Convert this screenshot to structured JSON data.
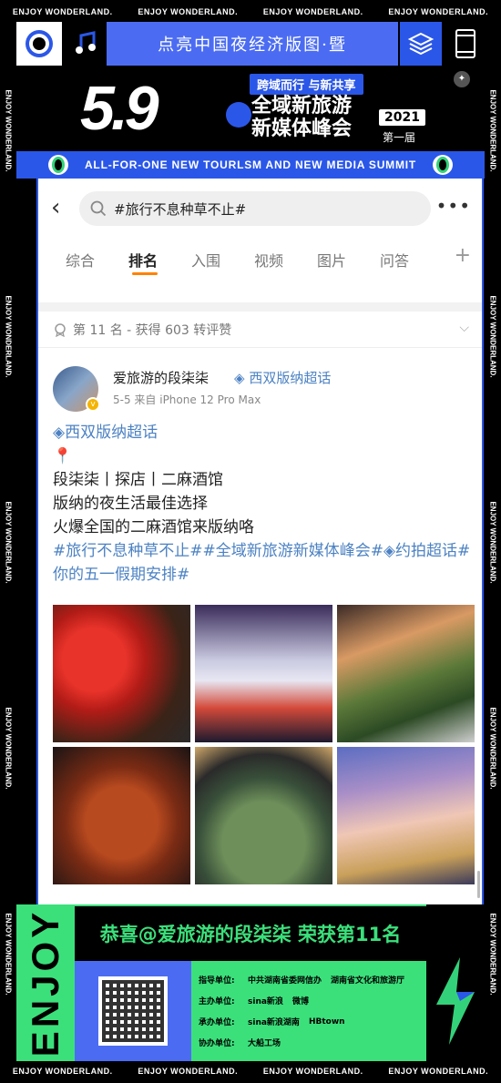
{
  "border": {
    "top_items": [
      "ENJOY WONDERLAND.",
      "ENJOY WONDERLAND.",
      "ENJOY WONDERLAND.",
      "ENJOY WONDERLAND."
    ],
    "bottom_items": [
      "ENJOY WONDERLAND.",
      "ENJOY WONDERLAND.",
      "ENJOY WONDERLAND.",
      "ENJOY WONDERLAND."
    ],
    "left_items": [
      "ENJOY WONDERLAND.",
      "ENJOY WONDERLAND.",
      "ENJOY WONDERLAND.",
      "ENJOY WONDERLAND.",
      "ENJOY WONDERLAND."
    ],
    "right_items": [
      "ENJOY WONDERLAND.",
      "ENJOY WONDERLAND.",
      "ENJOY WONDERLAND.",
      "ENJOY WONDERLAND.",
      "ENJOY WONDERLAND."
    ]
  },
  "header": {
    "banner_text": "点亮中国夜经济版图·暨"
  },
  "summit": {
    "number": "5.9",
    "tagline": "跨域而行  与新共享",
    "title_line1": "全域新旅游",
    "title_line2": "新媒体峰会",
    "year": "2021",
    "edition": "第一届",
    "band_text": "ALL-FOR-ONE NEW TOURLSM AND NEW MEDIA SUMMIT"
  },
  "app": {
    "search_query": "#旅行不息种草不止#",
    "tabs": [
      "综合",
      "排名",
      "入围",
      "视频",
      "图片",
      "问答"
    ],
    "active_tab": 1,
    "rank_text": "第 11 名 - 获得 603 转评赞",
    "post": {
      "username": "爱旅游的段柒柒",
      "user_topic": "西双版纳超话",
      "meta": "5-5  来自 iPhone 12 Pro Max",
      "topic_line": "西双版纳超话",
      "line1": "段柒柒丨探店丨二麻酒馆",
      "line2": "版纳的夜生活最佳选择",
      "line3": "火爆全国的二麻酒馆来版纳咯",
      "hashtags": "#旅行不息种草不止##全域新旅游新媒体峰会#◈约拍超话#你的五一假期安排#",
      "image_count": 6
    }
  },
  "footer": {
    "enjoy": "ENJOY",
    "congrats": "恭喜@爱旅游的段柒柒 荣获第11名",
    "org_rows": [
      {
        "k": "指导单位:",
        "v1": "中共湖南省委网信办",
        "v2": "湖南省文化和旅游厅"
      },
      {
        "k": "主办单位:",
        "v1": "sina新浪",
        "v2": "微博"
      },
      {
        "k": "承办单位:",
        "v1": "sina新浪湖南",
        "v2": "HBtown"
      },
      {
        "k": "协办单位:",
        "v1": "大船工场",
        "v2": ""
      }
    ]
  },
  "colors": {
    "accent_blue": "#2b57e8",
    "accent_green": "#3be07b",
    "link_blue": "#4c82c3",
    "active_tab_underline": "#ff8200"
  }
}
